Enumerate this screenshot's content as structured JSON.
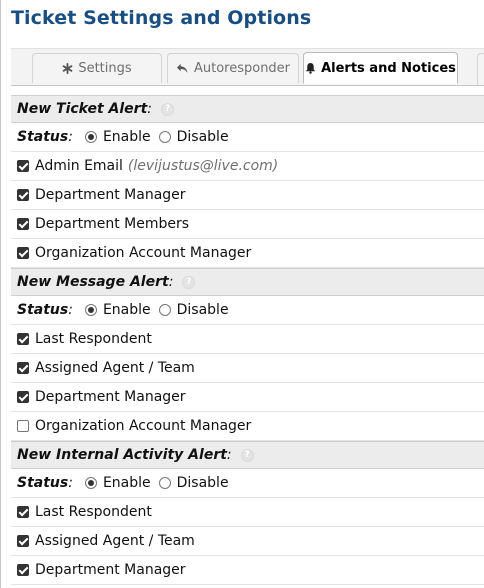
{
  "page_title": "Ticket Settings and Options",
  "tabs": [
    {
      "label": "Settings",
      "icon": "asterisk-icon"
    },
    {
      "label": "Autoresponder",
      "icon": "reply-arrow-icon"
    },
    {
      "label": "Alerts and Notices",
      "icon": "bell-icon",
      "active": true
    }
  ],
  "status_label": "Status",
  "enable_label": "Enable",
  "disable_label": "Disable",
  "sections": [
    {
      "title": "New Ticket Alert",
      "status": "Enable",
      "items": [
        {
          "label": "Admin Email",
          "extra": "(levijustus@live.com)",
          "checked": true
        },
        {
          "label": "Department Manager",
          "checked": true
        },
        {
          "label": "Department Members",
          "checked": true
        },
        {
          "label": "Organization Account Manager",
          "checked": true
        }
      ]
    },
    {
      "title": "New Message Alert",
      "status": "Enable",
      "items": [
        {
          "label": "Last Respondent",
          "checked": true
        },
        {
          "label": "Assigned Agent / Team",
          "checked": true
        },
        {
          "label": "Department Manager",
          "checked": true
        },
        {
          "label": "Organization Account Manager",
          "checked": false
        }
      ]
    },
    {
      "title": "New Internal Activity Alert",
      "status": "Enable",
      "items": [
        {
          "label": "Last Respondent",
          "checked": true
        },
        {
          "label": "Assigned Agent / Team",
          "checked": true
        },
        {
          "label": "Department Manager",
          "checked": true
        }
      ]
    }
  ]
}
